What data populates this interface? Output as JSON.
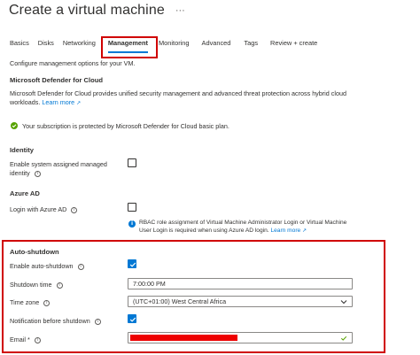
{
  "header": {
    "title": "Create a virtual machine",
    "more_label": "···"
  },
  "tabs": [
    {
      "label": "Basics"
    },
    {
      "label": "Disks"
    },
    {
      "label": "Networking"
    },
    {
      "label": "Management",
      "active": true
    },
    {
      "label": "Monitoring"
    },
    {
      "label": "Advanced"
    },
    {
      "label": "Tags"
    },
    {
      "label": "Review + create"
    }
  ],
  "intro": "Configure management options for your VM.",
  "defender": {
    "heading": "Microsoft Defender for Cloud",
    "desc_line1": "Microsoft Defender for Cloud provides unified security management and advanced threat protection across hybrid cloud",
    "desc_line2": "workloads.",
    "learn_more": "Learn more",
    "status": "Your subscription is protected by Microsoft Defender for Cloud basic plan."
  },
  "identity": {
    "heading": "Identity",
    "label_line1": "Enable system assigned managed",
    "label_line2": "identity",
    "checked": false
  },
  "azure_ad": {
    "heading": "Azure AD",
    "label": "Login with Azure AD",
    "checked": false,
    "info_line1": "RBAC role assignment of Virtual Machine Administrator Login or Virtual Machine",
    "info_line2": "User Login is required when using Azure AD login.",
    "learn_more": "Learn more"
  },
  "auto_shutdown": {
    "heading": "Auto-shutdown",
    "enable_label": "Enable auto-shutdown",
    "enable_checked": true,
    "time_label": "Shutdown time",
    "time_value": "7:00:00 PM",
    "zone_label": "Time zone",
    "zone_value": "(UTC+01:00) West Central Africa",
    "notify_label": "Notification before shutdown",
    "notify_checked": true,
    "email_label": "Email *"
  },
  "colors": {
    "accent": "#0078d4",
    "highlight": "#d00000",
    "success": "#57a300"
  }
}
